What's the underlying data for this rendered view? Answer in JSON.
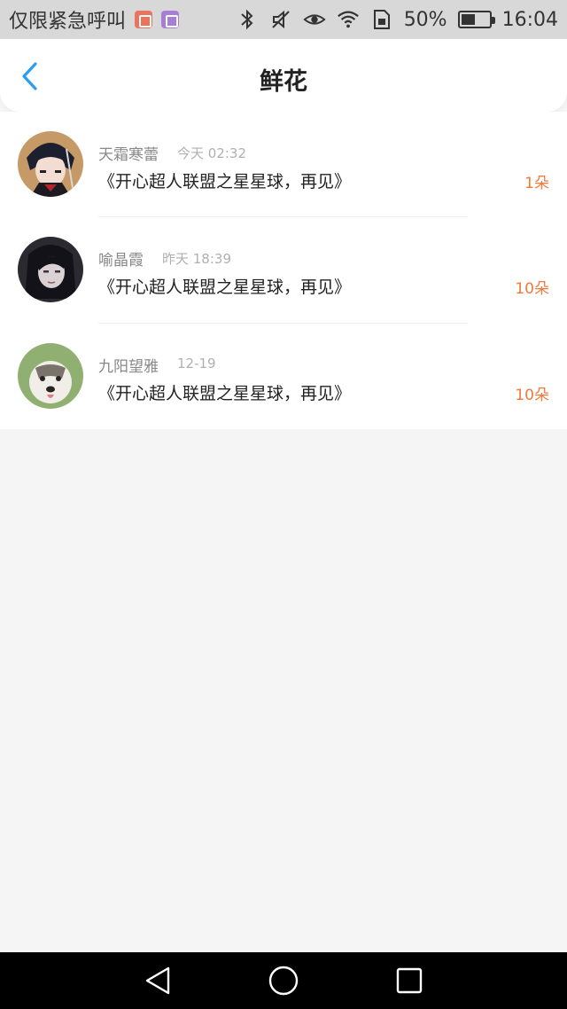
{
  "status_bar": {
    "carrier": "仅限紧急呼叫",
    "battery_percent": "50%",
    "battery_level": 0.5,
    "time": "16:04",
    "icons": [
      "notification-red-icon",
      "notification-purple-icon",
      "bluetooth-icon",
      "mute-icon",
      "eye-icon",
      "wifi-icon",
      "sim-icon",
      "battery-icon"
    ]
  },
  "header": {
    "title": "鲜花",
    "back_icon": "chevron-left-icon"
  },
  "colors": {
    "accent": "#2a9df4",
    "count": "#f07a3a"
  },
  "items": [
    {
      "name": "天霜寒蕾",
      "time": "今天 02:32",
      "message": "《开心超人联盟之星星球，再见》",
      "count": "1朵"
    },
    {
      "name": "喻晶霞",
      "time": "昨天 18:39",
      "message": "《开心超人联盟之星星球，再见》",
      "count": "10朵"
    },
    {
      "name": "九阳望雅",
      "time": "12-19",
      "message": "《开心超人联盟之星星球，再见》",
      "count": "10朵"
    }
  ]
}
